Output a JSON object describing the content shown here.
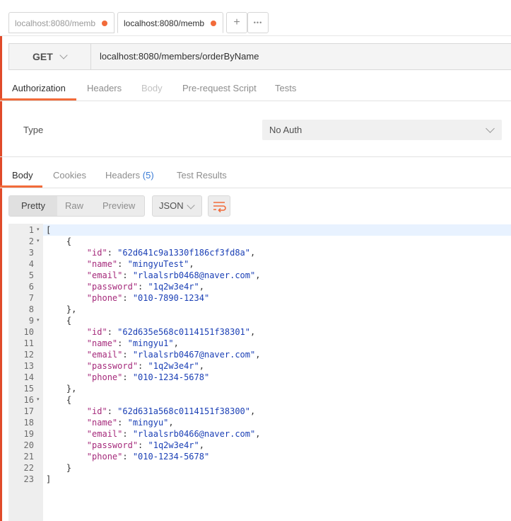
{
  "tabs": {
    "items": [
      {
        "label": "localhost:8080/memb"
      },
      {
        "label": "localhost:8080/memb"
      }
    ],
    "add_label": "+",
    "more_label": "•••"
  },
  "request": {
    "method": "GET",
    "url": "localhost:8080/members/orderByName"
  },
  "request_tabs": [
    "Authorization",
    "Headers",
    "Body",
    "Pre-request Script",
    "Tests"
  ],
  "auth": {
    "type_label": "Type",
    "type_value": "No Auth"
  },
  "response_tabs": {
    "body": "Body",
    "cookies": "Cookies",
    "headers": "Headers",
    "headers_count": "(5)",
    "tests": "Test Results"
  },
  "view_modes": [
    "Pretty",
    "Raw",
    "Preview"
  ],
  "format": "JSON",
  "members": [
    {
      "id": "62d641c9a1330f186cf3fd8a",
      "name": "mingyuTest",
      "email": "rlaalsrb0468@naver.com",
      "password": "1q2w3e4r",
      "phone": "010-7890-1234"
    },
    {
      "id": "62d635e568c0114151f38301",
      "name": "mingyu1",
      "email": "rlaalsrb0467@naver.com",
      "password": "1q2w3e4r",
      "phone": "010-1234-5678"
    },
    {
      "id": "62d631a568c0114151f38300",
      "name": "mingyu",
      "email": "rlaalsrb0466@naver.com",
      "password": "1q2w3e4r",
      "phone": "010-1234-5678"
    }
  ],
  "colors": {
    "accent": "#f26b3a",
    "json_key": "#a52a7b",
    "json_string": "#1a3fb5",
    "headers_count": "#3a7bd5"
  }
}
